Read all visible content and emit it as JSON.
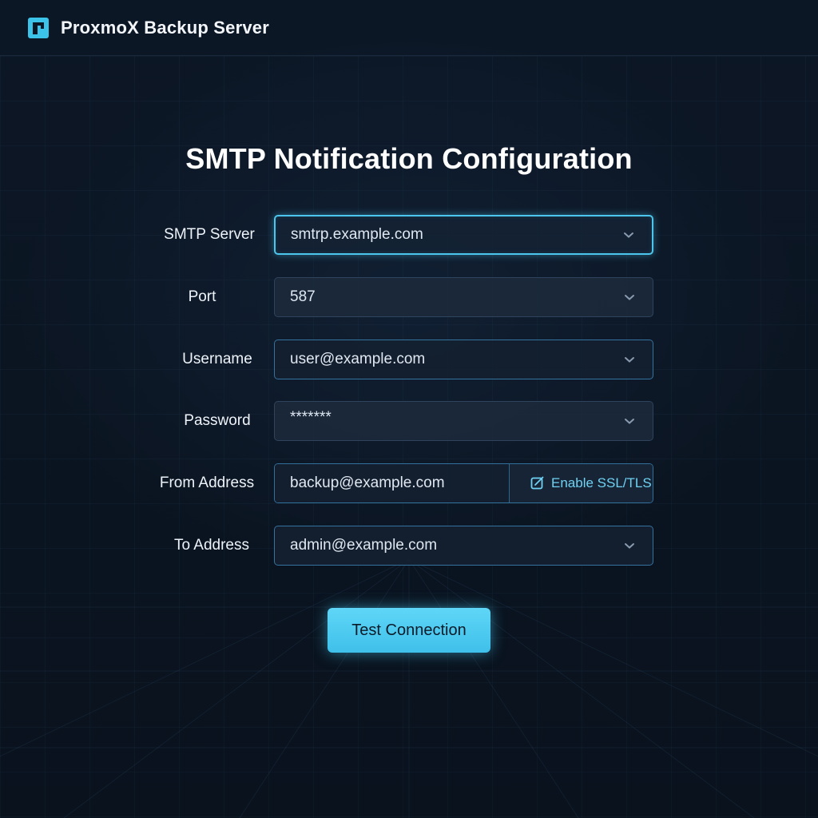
{
  "app": {
    "title": "ProxmoX Backup Server",
    "logo_icon": "proxmox-logo-icon"
  },
  "page": {
    "title": "SMTP Notification Configuration"
  },
  "form": {
    "smtp_server": {
      "label": "SMTP Server",
      "value": "smtrp.example.com"
    },
    "port": {
      "label": "Port",
      "value": "587"
    },
    "username": {
      "label": "Username",
      "value": "user@example.com"
    },
    "password": {
      "label": "Password",
      "value": "*******"
    },
    "from_address": {
      "label": "From Address",
      "value": "backup@example.com",
      "ssl_label": "Enable SSL/TLS",
      "ssl_checked": true
    },
    "to_address": {
      "label": "To Address",
      "value": "admin@example.com"
    }
  },
  "actions": {
    "test_label": "Test Connection"
  },
  "colors": {
    "accent": "#4cc6ec",
    "button": "#4fcbf1",
    "background": "#0b1522"
  }
}
